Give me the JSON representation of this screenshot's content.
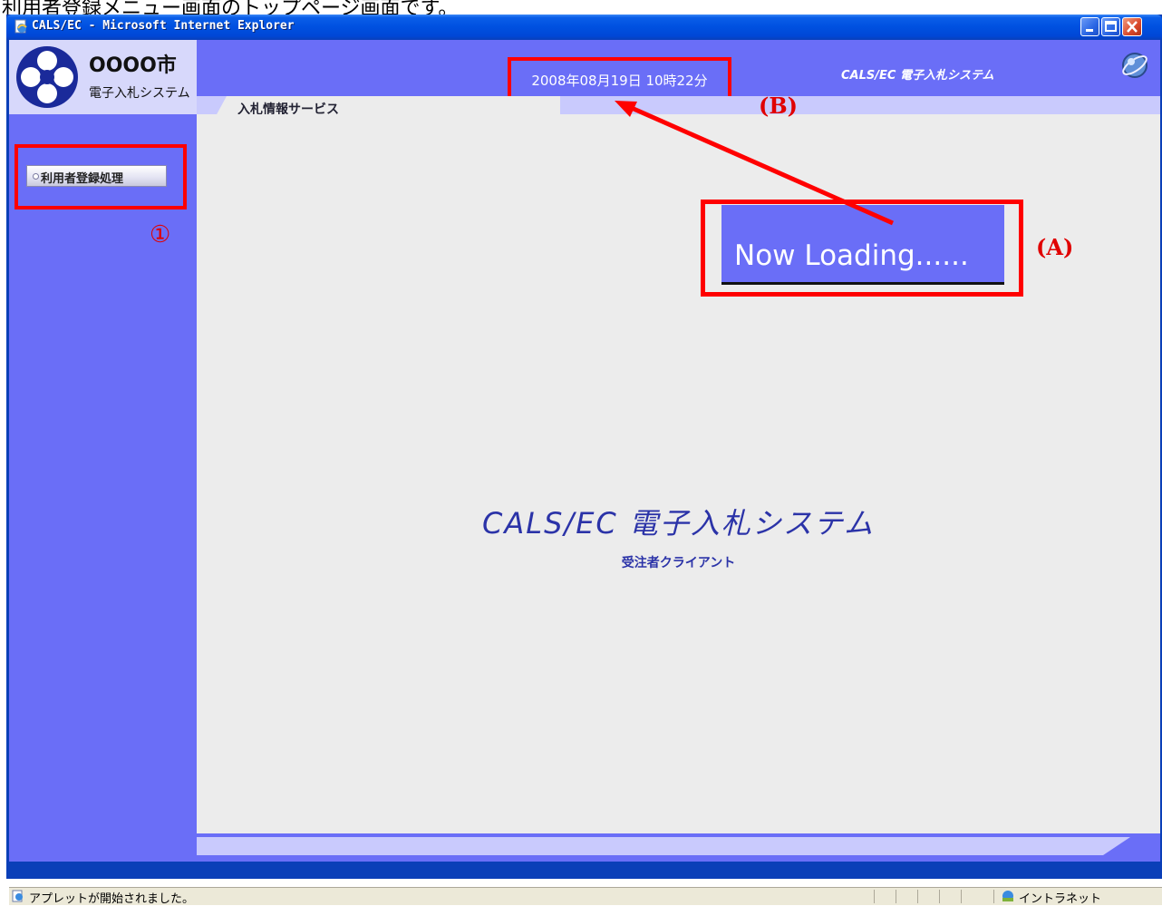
{
  "doc_heading": "利用者登録メニュー画面のトップページ画面です。",
  "window": {
    "title": "CALS/EC - Microsoft Internet Explorer"
  },
  "header": {
    "city": "OOOO市",
    "system_short": "電子入札システム",
    "datetime": "2008年08月19日 10時22分",
    "system_name": "CALS/EC 電子入札システム",
    "tab": "入札情報サービス"
  },
  "sidebar": {
    "items": [
      {
        "label": "利用者登録処理"
      }
    ]
  },
  "main": {
    "title": "CALS/EC 電子入札システム",
    "subtitle": "受注者クライアント",
    "loading": "Now Loading......"
  },
  "annotations": {
    "a": "(A)",
    "b": "(B)",
    "one": "①"
  },
  "statusbar": {
    "message": "アプレットが開始されました。",
    "zone": "イントラネット"
  },
  "colors": {
    "brand": "#6a6ef7",
    "brand_light": "#c9cafd",
    "annotation": "#ff0000",
    "title_text": "#2b33a8"
  }
}
